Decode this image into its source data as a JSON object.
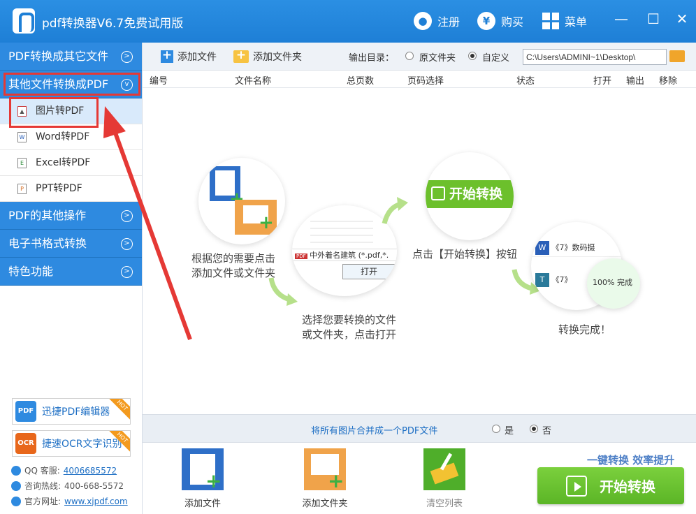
{
  "app": {
    "title": "pdf转换器V6.7免费试用版"
  },
  "titlebar": {
    "register": "注册",
    "buy": "购买",
    "menu": "菜单",
    "buy_glyph": "¥",
    "min": "—",
    "max": "☐",
    "close": "✕"
  },
  "sidebar": {
    "sections": [
      "PDF转换成其它文件",
      "其他文件转换成PDF",
      "PDF的其他操作",
      "电子书格式转换",
      "特色功能"
    ],
    "subitems": [
      {
        "label": "图片转PDF",
        "icon": "image-file-icon"
      },
      {
        "label": "Word转PDF",
        "icon": "word-file-icon",
        "glyph": "W"
      },
      {
        "label": "Excel转PDF",
        "icon": "excel-file-icon",
        "glyph": "E"
      },
      {
        "label": "PPT转PDF",
        "icon": "ppt-file-icon",
        "glyph": "P"
      }
    ],
    "promos": [
      {
        "label": "迅捷PDF编辑器",
        "logo": "PDF",
        "color": "#2e8ae0"
      },
      {
        "label": "捷速OCR文字识别",
        "logo": "OCR",
        "color": "#e8671b"
      }
    ],
    "hot_badge": "HOT",
    "contacts": [
      {
        "label": "QQ 客服:",
        "value": "4006685572"
      },
      {
        "label": "咨询热线:",
        "value": "400-668-5572"
      },
      {
        "label": "官方网址:",
        "value": "www.xjpdf.com"
      }
    ]
  },
  "toolbar": {
    "add_file": "添加文件",
    "add_folder": "添加文件夹",
    "output_label": "输出目录：",
    "opt_original": "原文件夹",
    "opt_custom": "自定义",
    "output_path": "C:\\Users\\ADMINI~1\\Desktop\\"
  },
  "table": {
    "headers": [
      "编号",
      "文件名称",
      "总页数",
      "页码选择",
      "状态",
      "打开",
      "输出",
      "移除"
    ]
  },
  "guide": {
    "step1": [
      "根据您的需要点击",
      "添加文件或文件夹"
    ],
    "step2": [
      "选择您要转换的文件",
      "或文件夹，点击打开"
    ],
    "step3": "点击【开始转换】按钮",
    "step4": "转换完成！",
    "dialog_file": "中外着名建筑",
    "dialog_filter": "(*.pdf,*.",
    "dialog_open": "打开",
    "start_label": "开始转换",
    "done_item1": "《7》数码摄",
    "done_item2": "《7》",
    "done_progress": "100%",
    "done_status": "完成"
  },
  "merge": {
    "label": "将所有图片合并成一个PDF文件",
    "yes": "是",
    "no": "否"
  },
  "bottom": {
    "add_file": "添加文件",
    "add_folder": "添加文件夹",
    "clear_list": "清空列表",
    "slogan": "一键转换  效率提升",
    "start": "开始转换"
  }
}
